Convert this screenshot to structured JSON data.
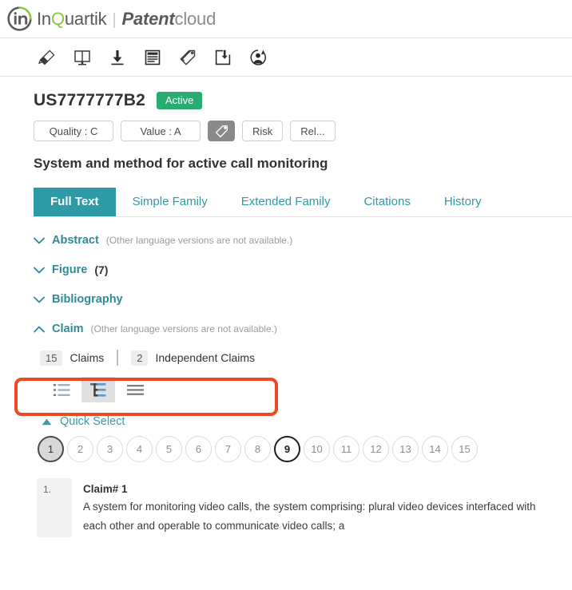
{
  "brand": {
    "logo_icon": "inquartik-circle-logo",
    "name_in": "In",
    "name_q": "Q",
    "name_uartik": "uartik",
    "separator": "|",
    "product_bold": "Patent",
    "product_light": "cloud"
  },
  "toolbar": {
    "items": [
      {
        "icon": "highlighter-icon",
        "label": "Highlight"
      },
      {
        "icon": "compare-monitor-icon",
        "label": "Compare"
      },
      {
        "icon": "download-icon",
        "label": "Download"
      },
      {
        "icon": "document-list-icon",
        "label": "Document"
      },
      {
        "icon": "tag-icon",
        "label": "Tag"
      },
      {
        "icon": "export-folder-icon",
        "label": "Export"
      },
      {
        "icon": "user-refresh-icon",
        "label": "Assignee"
      }
    ]
  },
  "patent": {
    "number": "US7777777B2",
    "status": "Active",
    "status_color": "#2aab71",
    "title": "System and method for active call monitoring",
    "badges": [
      {
        "name": "quality",
        "label": "Quality : C"
      },
      {
        "name": "value",
        "label": "Value : A"
      },
      {
        "name": "tag",
        "label": "",
        "icon": "tag-icon",
        "selected": true
      },
      {
        "name": "risk",
        "label": "Risk"
      },
      {
        "name": "related",
        "label": "Rel..."
      }
    ]
  },
  "tabs": [
    {
      "label": "Full Text",
      "active": true
    },
    {
      "label": "Simple Family",
      "active": false
    },
    {
      "label": "Extended Family",
      "active": false
    },
    {
      "label": "Citations",
      "active": false
    },
    {
      "label": "History",
      "active": false
    }
  ],
  "tab_accent": "#2e9aa6",
  "sections": [
    {
      "name": "abstract",
      "title": "Abstract",
      "note": "(Other language versions are not available.)",
      "count": "",
      "expanded": false
    },
    {
      "name": "figure",
      "title": "Figure",
      "note": "",
      "count": "(7)",
      "expanded": false
    },
    {
      "name": "bibliography",
      "title": "Bibliography",
      "note": "",
      "count": "",
      "expanded": false
    },
    {
      "name": "claim",
      "title": "Claim",
      "note": "(Other language versions are not available.)",
      "count": "",
      "expanded": true
    }
  ],
  "claims_summary": {
    "total_count": "15",
    "total_label": "Claims",
    "independent_count": "2",
    "independent_label": "Independent Claims",
    "highlight_color": "#ec4a22"
  },
  "view_modes": [
    {
      "name": "bullet-list-view",
      "icon": "bullet-list-icon",
      "selected": false
    },
    {
      "name": "tree-view",
      "icon": "tree-hierarchy-icon",
      "selected": true
    },
    {
      "name": "plain-list-view",
      "icon": "lines-list-icon",
      "selected": false
    }
  ],
  "quick_select": {
    "label": "Quick Select",
    "expanded": true,
    "numbers": [
      {
        "n": "1",
        "state": "selected"
      },
      {
        "n": "2",
        "state": "normal"
      },
      {
        "n": "3",
        "state": "normal"
      },
      {
        "n": "4",
        "state": "normal"
      },
      {
        "n": "5",
        "state": "normal"
      },
      {
        "n": "6",
        "state": "normal"
      },
      {
        "n": "7",
        "state": "normal"
      },
      {
        "n": "8",
        "state": "normal"
      },
      {
        "n": "9",
        "state": "independent"
      },
      {
        "n": "10",
        "state": "normal"
      },
      {
        "n": "11",
        "state": "normal"
      },
      {
        "n": "12",
        "state": "normal"
      },
      {
        "n": "13",
        "state": "normal"
      },
      {
        "n": "14",
        "state": "normal"
      },
      {
        "n": "15",
        "state": "normal"
      }
    ]
  },
  "claim_body": {
    "index": "1.",
    "heading": "Claim# 1",
    "text": "A system for monitoring video calls, the system comprising: plural video devices interfaced with each other and operable to communicate video calls; a"
  }
}
